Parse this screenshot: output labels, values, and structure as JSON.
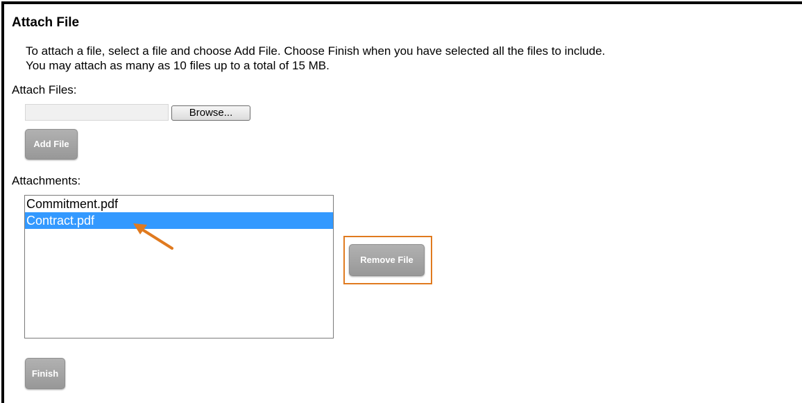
{
  "dialog": {
    "title": "Attach File",
    "instructions_line1": "To attach a file, select a file and choose Add File. Choose Finish when you have selected all the files to include.",
    "instructions_line2": "You may attach as many as 10 files up to a total of 15 MB.",
    "attach_files_label": "Attach Files:",
    "file_input_value": "",
    "browse_label": "Browse...",
    "add_file_label": "Add File",
    "attachments_label": "Attachments:",
    "attachments": [
      {
        "name": "Commitment.pdf",
        "selected": false
      },
      {
        "name": "Contract.pdf",
        "selected": true
      }
    ],
    "remove_file_label": "Remove File",
    "finish_label": "Finish"
  },
  "colors": {
    "selection": "#3399ff",
    "annotation": "#e07a1f",
    "button_gray": "#a5a5a5"
  },
  "icons": {
    "annotation_arrow": "arrow-pointer-icon"
  }
}
